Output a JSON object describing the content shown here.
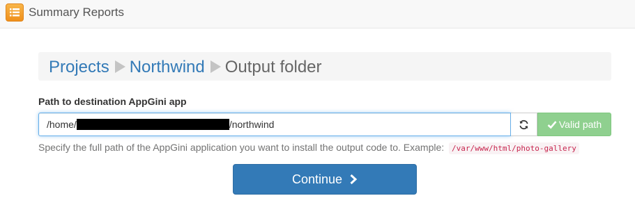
{
  "header": {
    "app_title": "Summary Reports",
    "icon": "list-icon"
  },
  "breadcrumb": {
    "items": [
      {
        "label": "Projects"
      },
      {
        "label": "Northwind"
      }
    ],
    "current": "Output folder",
    "separator_icon": "triangle-right-icon"
  },
  "form": {
    "label": "Path to destination AppGini app",
    "path_prefix": "/home/",
    "path_suffix": "/northwind",
    "refresh_icon": "refresh-icon",
    "status_label": "Valid path",
    "status_icon": "checkmark-icon",
    "help_text": "Specify the full path of the AppGini application you want to install the output code to. Example:",
    "example": "/var/www/html/photo-gallery"
  },
  "actions": {
    "continue_label": "Continue",
    "continue_icon": "chevron-right-icon"
  },
  "colors": {
    "accent": "#337ab7",
    "success": "#8fd08f",
    "app_icon": "#f0a030"
  }
}
